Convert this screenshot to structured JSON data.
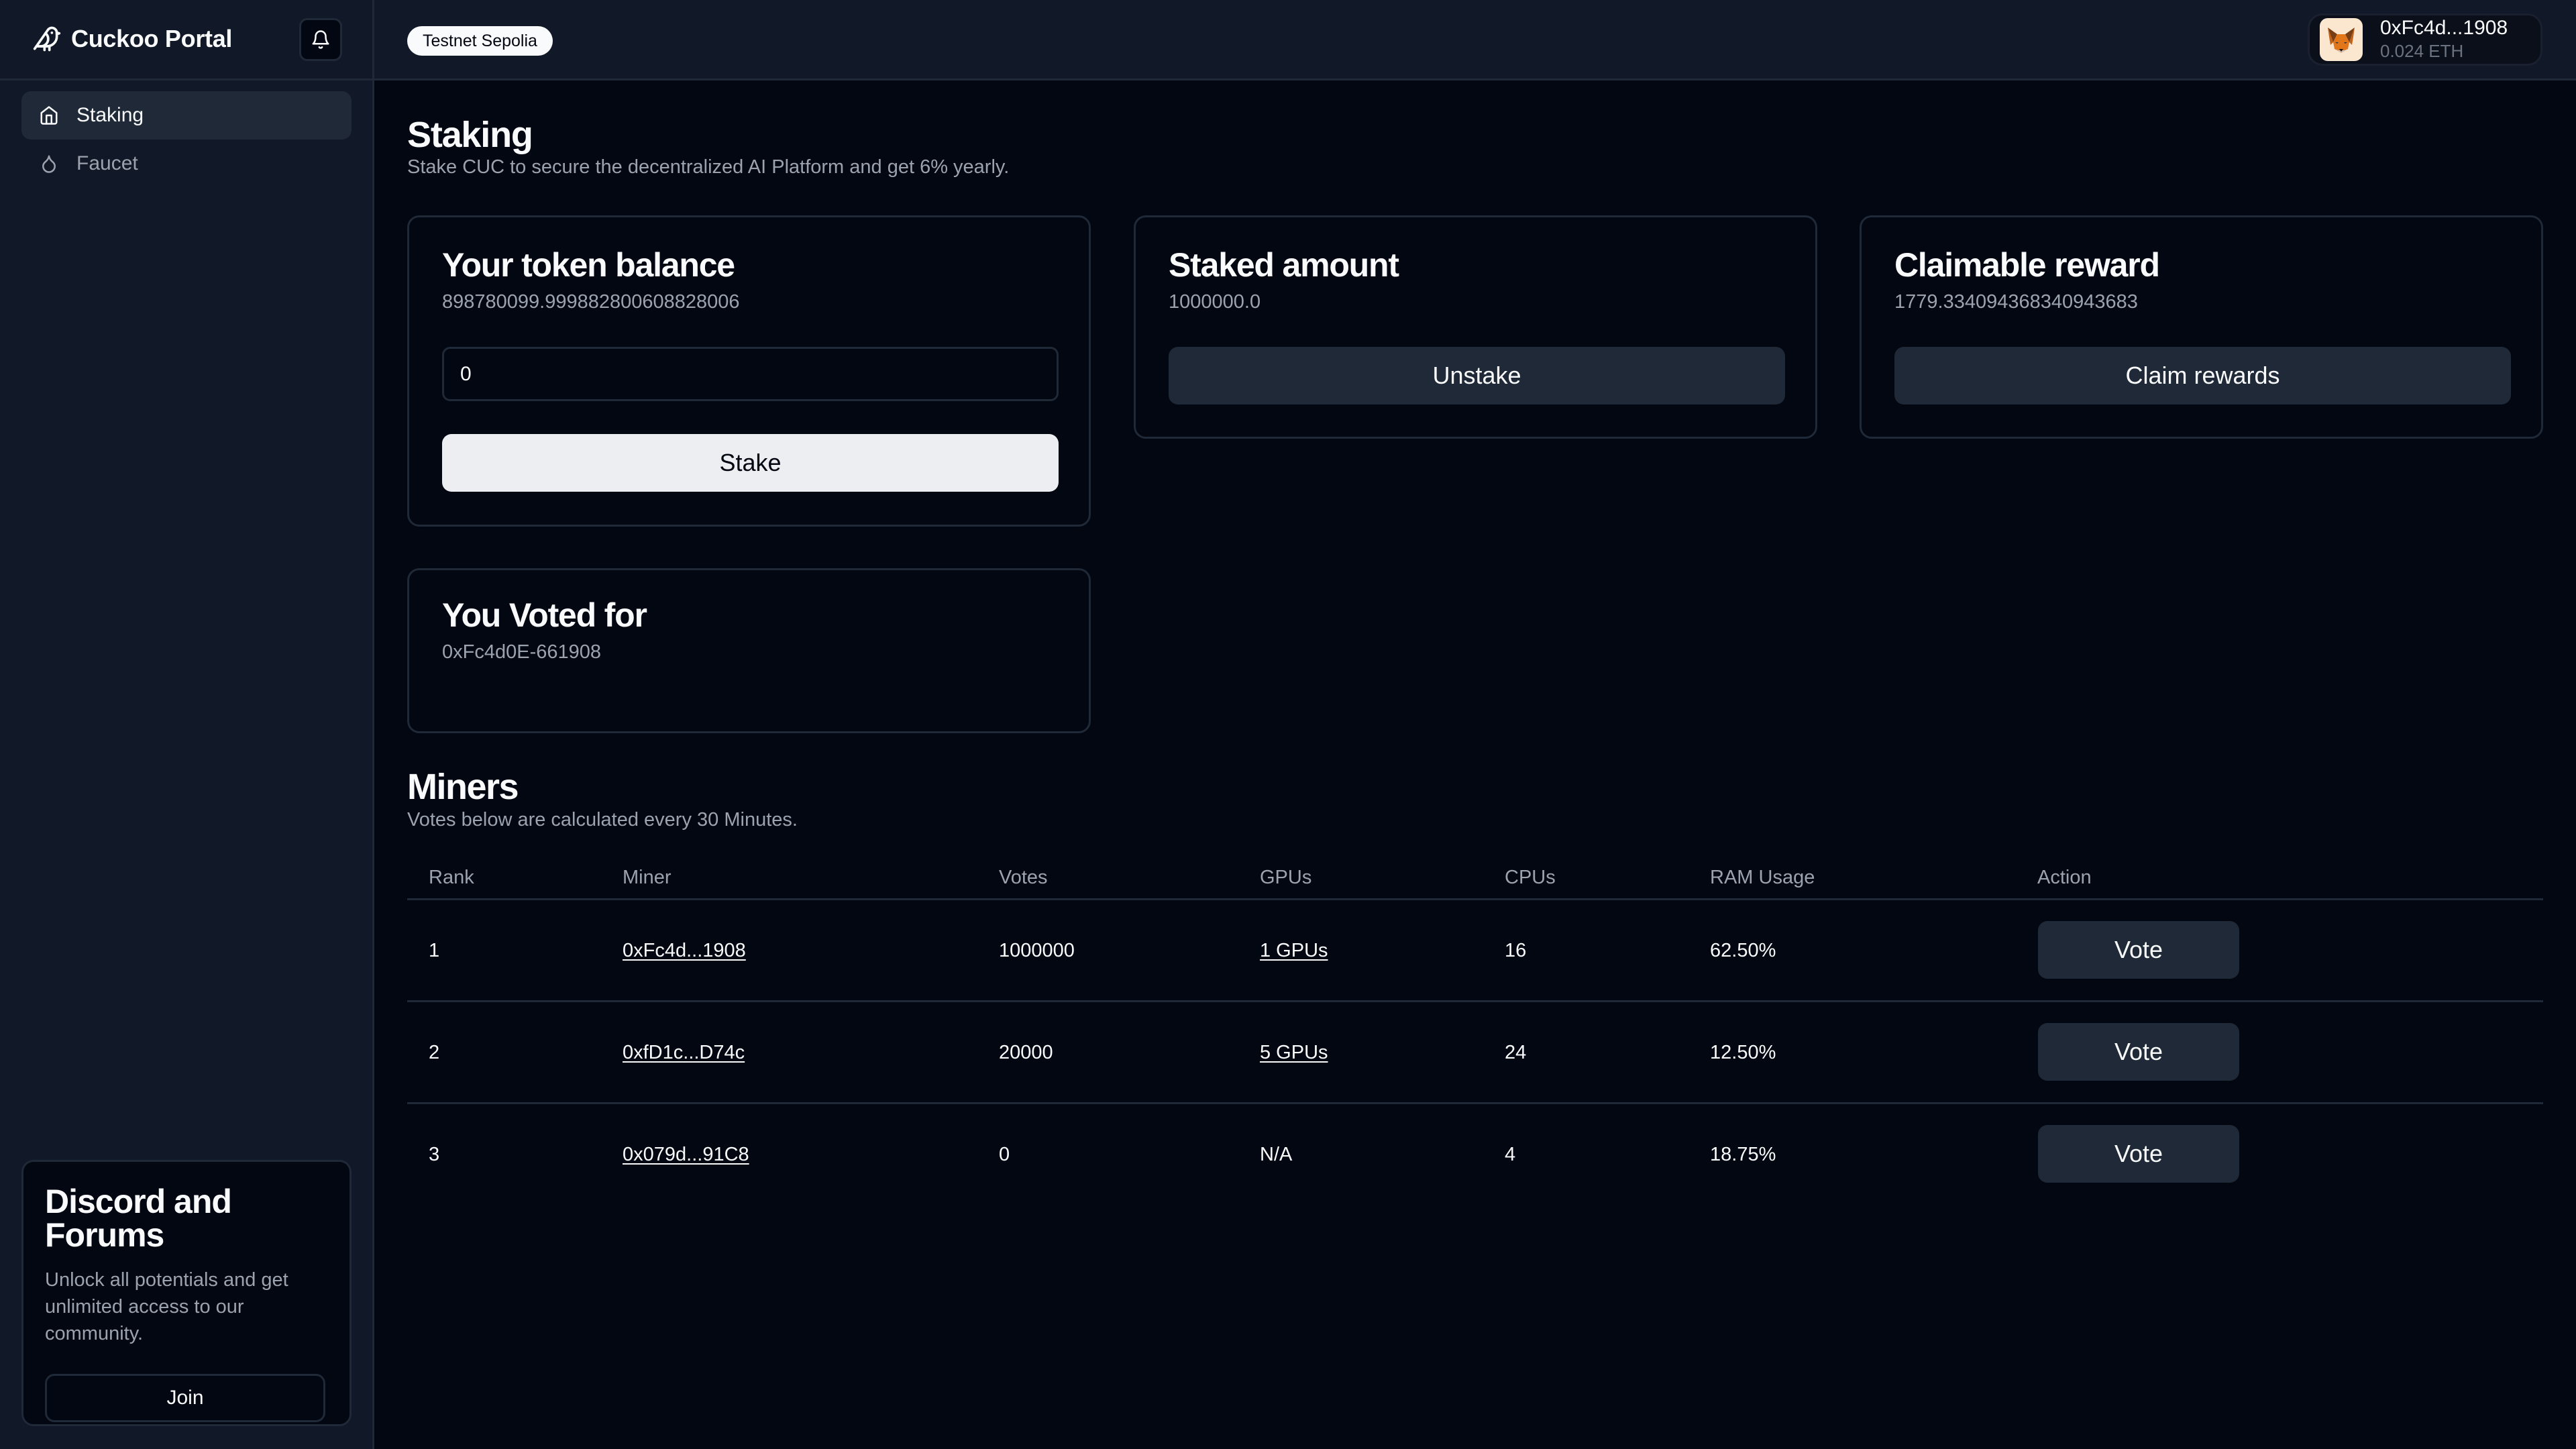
{
  "app": {
    "title": "Cuckoo Portal",
    "logo_icon": "bird-icon",
    "notifications_icon": "bell-icon"
  },
  "sidebar": {
    "items": [
      {
        "label": "Staking",
        "icon": "home-icon",
        "active": true
      },
      {
        "label": "Faucet",
        "icon": "droplet-icon",
        "active": false
      }
    ],
    "promo": {
      "title": "Discord and Forums",
      "description": "Unlock all potentials and get unlimited access to our community.",
      "button_label": "Join"
    }
  },
  "topbar": {
    "network_badge": "Testnet Sepolia",
    "wallet": {
      "address": "0xFc4d...1908",
      "balance": "0.024 ETH",
      "avatar_icon": "metamask-fox-icon"
    }
  },
  "staking": {
    "title": "Staking",
    "subtitle": "Stake CUC to secure the decentralized AI Platform and get 6% yearly.",
    "balance_card": {
      "title": "Your token balance",
      "value": "898780099.999882800608828006",
      "input_value": "0",
      "button_label": "Stake"
    },
    "staked_card": {
      "title": "Staked amount",
      "value": "1000000.0",
      "button_label": "Unstake"
    },
    "reward_card": {
      "title": "Claimable reward",
      "value": "1779.334094368340943683",
      "button_label": "Claim rewards"
    },
    "voted_card": {
      "title": "You Voted for",
      "value": "0xFc4d0E-661908"
    }
  },
  "miners": {
    "title": "Miners",
    "subtitle": "Votes below are calculated every 30 Minutes.",
    "columns": [
      "Rank",
      "Miner",
      "Votes",
      "GPUs",
      "CPUs",
      "RAM Usage",
      "Action"
    ],
    "rows": [
      {
        "rank": "1",
        "miner": "0xFc4d...1908",
        "votes": "1000000",
        "gpus": "1 GPUs",
        "gpus_link": true,
        "cpus": "16",
        "ram": "62.50%",
        "action": "Vote"
      },
      {
        "rank": "2",
        "miner": "0xfD1c...D74c",
        "votes": "20000",
        "gpus": "5 GPUs",
        "gpus_link": true,
        "cpus": "24",
        "ram": "12.50%",
        "action": "Vote"
      },
      {
        "rank": "3",
        "miner": "0x079d...91C8",
        "votes": "0",
        "gpus": "N/A",
        "gpus_link": false,
        "cpus": "4",
        "ram": "18.75%",
        "action": "Vote"
      }
    ]
  }
}
